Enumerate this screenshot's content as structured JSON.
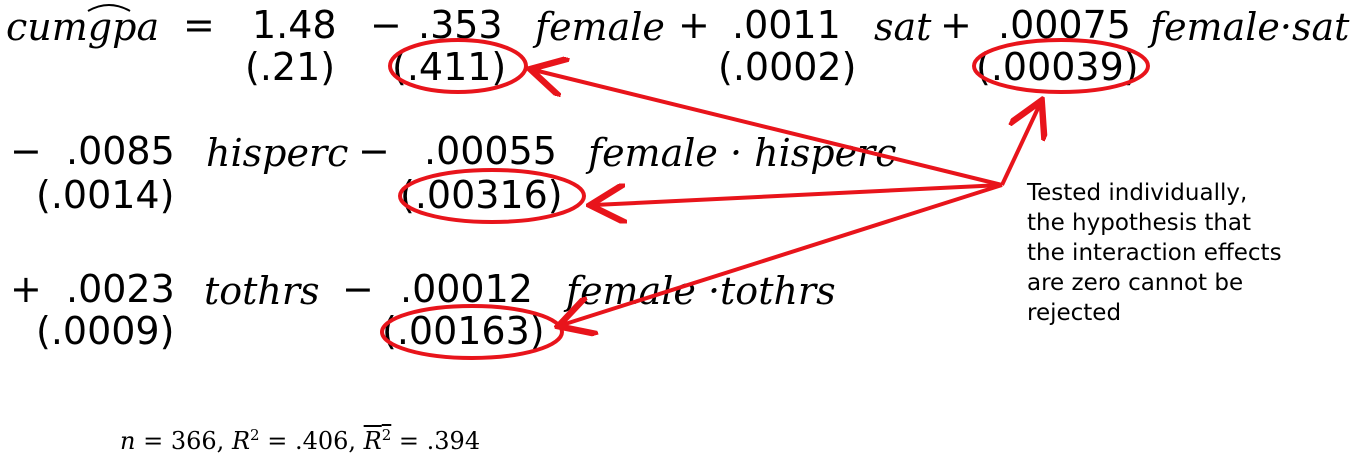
{
  "equation": {
    "line1": {
      "lhs": "cumgpa",
      "equals": "=",
      "intercept": "1.48",
      "op1": "−",
      "coef_female": ".353",
      "var_female": "female",
      "op2": "+",
      "coef_sat": ".0011",
      "var_sat": "sat",
      "op3": "+",
      "coef_female_sat": ".00075",
      "var_female_sat": "female·sat"
    },
    "se1": {
      "intercept": "(.21)",
      "female": "(.411)",
      "sat": "(.0002)",
      "female_sat": "(.00039)"
    },
    "line2": {
      "op1": "−",
      "coef_hisperc": ".0085",
      "var_hisperc": "hisperc",
      "op2": "−",
      "coef_female_hisperc": ".00055",
      "var_female_hisperc": "female · hisperc"
    },
    "se2": {
      "hisperc": "(.0014)",
      "female_hisperc": "(.00316)"
    },
    "line3": {
      "op1": "+",
      "coef_tothrs": ".0023",
      "var_tothrs": "tothrs",
      "op2": "−",
      "coef_female_tothrs": ".00012",
      "var_female_tothrs": "female ·tothrs"
    },
    "se3": {
      "tothrs": "(.0009)",
      "female_tothrs": "(.00163)"
    }
  },
  "annotation": {
    "lines": [
      "Tested individually,",
      "the hypothesis that",
      "the interaction effects",
      "are zero cannot be",
      "rejected"
    ]
  },
  "stats": {
    "n_label": "n",
    "n_value": "= 366,",
    "r2_label": "R",
    "r2_value": "= .406,",
    "adj_r2_label": "R",
    "adj_r2_value": "= .394",
    "sup": "2"
  },
  "colors": {
    "highlight": "#e8141b",
    "text": "#000000"
  }
}
